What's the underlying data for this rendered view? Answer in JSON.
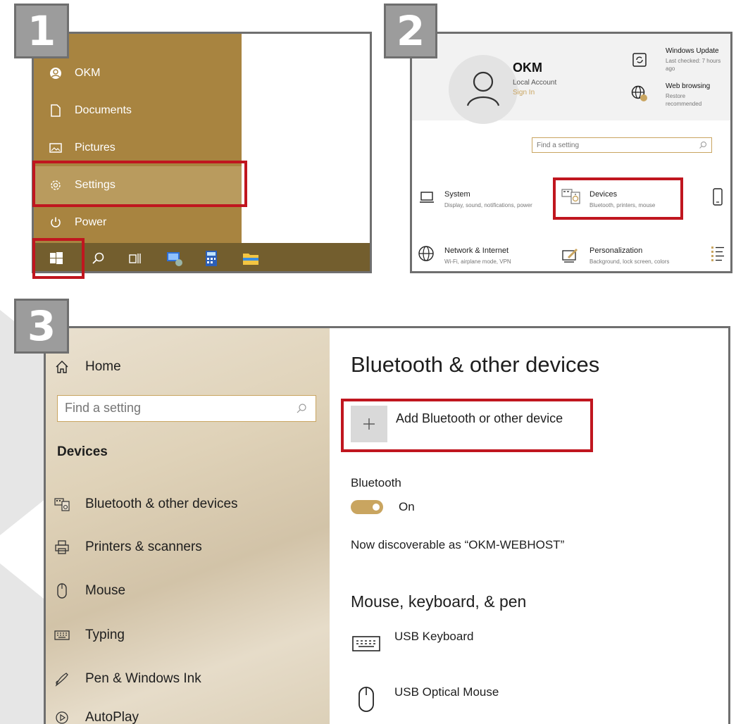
{
  "steps": [
    "1",
    "2",
    "3"
  ],
  "colors": {
    "accent": "#c9a560",
    "start_menu": "#a88440",
    "taskbar": "#735e2e",
    "highlight": "#c0161f",
    "badge": "#9c9c9c"
  },
  "start_menu": {
    "items": [
      {
        "label": "OKM",
        "icon": "user-icon"
      },
      {
        "label": "Documents",
        "icon": "document-icon"
      },
      {
        "label": "Pictures",
        "icon": "pictures-icon"
      },
      {
        "label": "Settings",
        "icon": "gear-icon"
      },
      {
        "label": "Power",
        "icon": "power-icon"
      }
    ]
  },
  "taskbar": {
    "icons": [
      "windows-start-icon",
      "search-icon",
      "task-view-icon",
      "network-app-icon",
      "calculator-icon",
      "file-explorer-icon"
    ]
  },
  "settings_home": {
    "user_name": "OKM",
    "account_type": "Local Account",
    "sign_in": "Sign In",
    "windows_update": {
      "title": "Windows Update",
      "subtitle": "Last checked: 7 hours ago"
    },
    "web_browsing": {
      "title": "Web browsing",
      "subtitle": "Restore recommended"
    },
    "search_placeholder": "Find a setting",
    "categories": [
      {
        "title": "System",
        "subtitle": "Display, sound, notifications, power"
      },
      {
        "title": "Devices",
        "subtitle": "Bluetooth, printers, mouse"
      },
      {
        "title": "Network & Internet",
        "subtitle": "Wi-Fi, airplane mode, VPN"
      },
      {
        "title": "Personalization",
        "subtitle": "Background, lock screen, colors"
      }
    ]
  },
  "devices_page": {
    "sidebar": {
      "home": "Home",
      "search_placeholder": "Find a setting",
      "section": "Devices",
      "items": [
        {
          "label": "Bluetooth & other devices",
          "icon": "bluetooth-devices-icon"
        },
        {
          "label": "Printers & scanners",
          "icon": "printer-icon"
        },
        {
          "label": "Mouse",
          "icon": "mouse-icon"
        },
        {
          "label": "Typing",
          "icon": "keyboard-icon"
        },
        {
          "label": "Pen & Windows Ink",
          "icon": "pen-icon"
        },
        {
          "label": "AutoPlay",
          "icon": "autoplay-icon"
        }
      ]
    },
    "main": {
      "title": "Bluetooth & other devices",
      "add_device": "Add Bluetooth or other device",
      "bluetooth_label": "Bluetooth",
      "bluetooth_state": "On",
      "discoverable": "Now discoverable as “OKM-WEBHOST”",
      "peripherals_heading": "Mouse, keyboard, & pen",
      "devices": [
        {
          "name": "USB Keyboard",
          "icon": "keyboard-icon"
        },
        {
          "name": "USB Optical Mouse",
          "icon": "mouse-icon"
        }
      ]
    }
  }
}
